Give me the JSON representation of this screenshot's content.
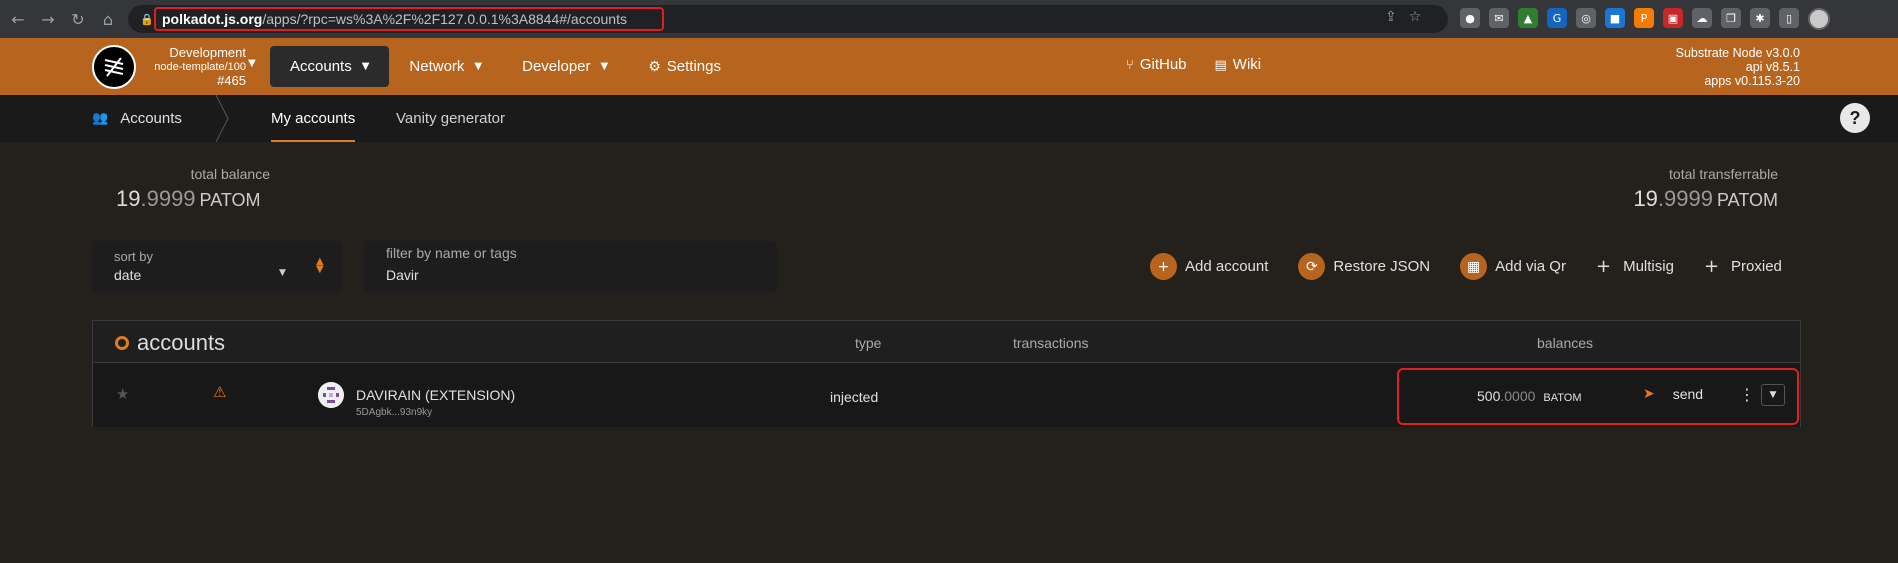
{
  "browser": {
    "url_host": "polkadot.js.org",
    "url_rest": "/apps/?rpc=ws%3A%2F%2F127.0.0.1%3A8844#/accounts"
  },
  "header": {
    "chain_name": "Development",
    "chain_sub": "node-template/100",
    "block": "#465",
    "menu": [
      {
        "label": "Accounts"
      },
      {
        "label": "Network"
      },
      {
        "label": "Developer"
      },
      {
        "label": "Settings"
      }
    ],
    "links": [
      {
        "label": "GitHub"
      },
      {
        "label": "Wiki"
      }
    ],
    "versions": [
      "Substrate Node v3.0.0",
      "api v8.5.1",
      "apps v0.115.3-20"
    ]
  },
  "tabs": {
    "section": "Accounts",
    "items": [
      {
        "label": "My accounts"
      },
      {
        "label": "Vanity generator"
      }
    ],
    "help": "?"
  },
  "summary": {
    "total_balance_label": "total balance",
    "total_balance_int": "19",
    "total_balance_dec": ".9999",
    "total_balance_unit": "PATOM",
    "total_transferrable_label": "total transferrable",
    "total_transferrable_int": "19",
    "total_transferrable_dec": ".9999",
    "total_transferrable_unit": "PATOM"
  },
  "filters": {
    "sort_label": "sort by",
    "sort_value": "date",
    "filter_label": "filter by name or tags",
    "filter_value": "Davir"
  },
  "actions": [
    {
      "label": "Add account"
    },
    {
      "label": "Restore JSON"
    },
    {
      "label": "Add via Qr"
    },
    {
      "label": "Multisig"
    },
    {
      "label": "Proxied"
    }
  ],
  "table": {
    "title": "accounts",
    "columns": {
      "type": "type",
      "transactions": "transactions",
      "balances": "balances"
    },
    "rows": [
      {
        "name": "DAVIRAIN (EXTENSION)",
        "address": "5DAgbk...93n9ky",
        "type": "injected",
        "balance_int": "500",
        "balance_dec": ".0000",
        "balance_unit": "BATOM",
        "send": "send"
      }
    ]
  },
  "colors": {
    "accent": "#b7651e",
    "highlight": "#e02020"
  }
}
